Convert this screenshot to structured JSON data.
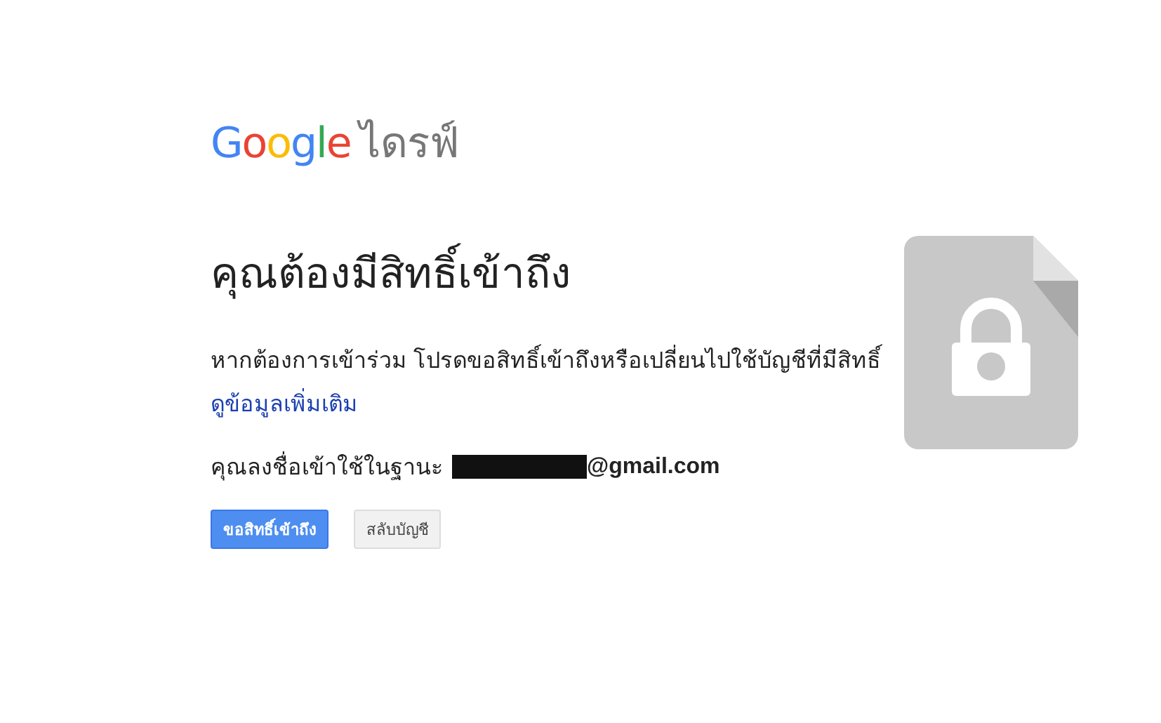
{
  "logo": {
    "brand": "Google",
    "product": "ไดรฟ์"
  },
  "heading": "คุณต้องมีสิทธิ์เข้าถึง",
  "message": "หากต้องการเข้าร่วม โปรดขอสิทธิ์เข้าถึงหรือเปลี่ยนไปใช้บัญชีที่มีสิทธิ์",
  "learn_more_link": "ดูข้อมูลเพิ่มเติม",
  "account": {
    "label": "คุณลงชื่อเข้าใช้ในฐานะ",
    "redacted": true,
    "email": "@gmail.com"
  },
  "buttons": [
    {
      "label": "ขอสิทธิ์เข้าถึง",
      "kind": "primary"
    },
    {
      "label": "สลับบัญชี",
      "kind": "secondary"
    }
  ]
}
